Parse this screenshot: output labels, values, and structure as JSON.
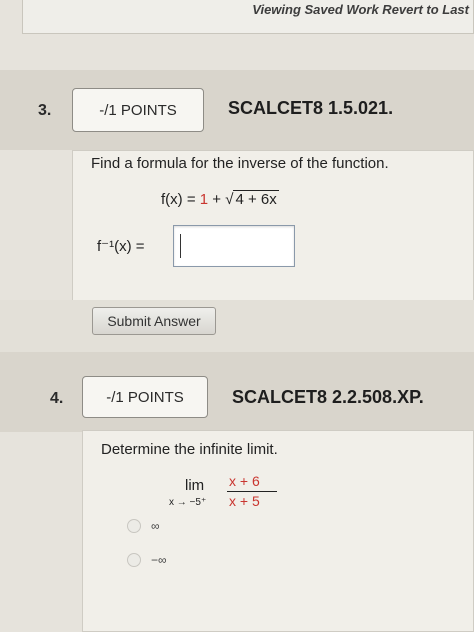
{
  "header": {
    "status_text": "Viewing Saved Work Revert to Last"
  },
  "questions": [
    {
      "number": "3.",
      "points": "-/1 POINTS",
      "code": "SCALCET8 1.5.021.",
      "prompt": "Find a formula for the inverse of the function.",
      "function": {
        "lhs": "f(x) =",
        "const": "1",
        "plus": "+",
        "radicand": "4 + 6x"
      },
      "answer_label": "f⁻¹(x) =",
      "answer_value": "",
      "submit_label": "Submit Answer"
    },
    {
      "number": "4.",
      "points": "-/1 POINTS",
      "code": "SCALCET8 2.2.508.XP.",
      "prompt": "Determine the infinite limit.",
      "limit": {
        "lim": "lim",
        "sub": "x → −5⁺",
        "numerator": "x + 6",
        "denominator": "x + 5"
      },
      "options": [
        "∞",
        "−∞"
      ]
    }
  ]
}
